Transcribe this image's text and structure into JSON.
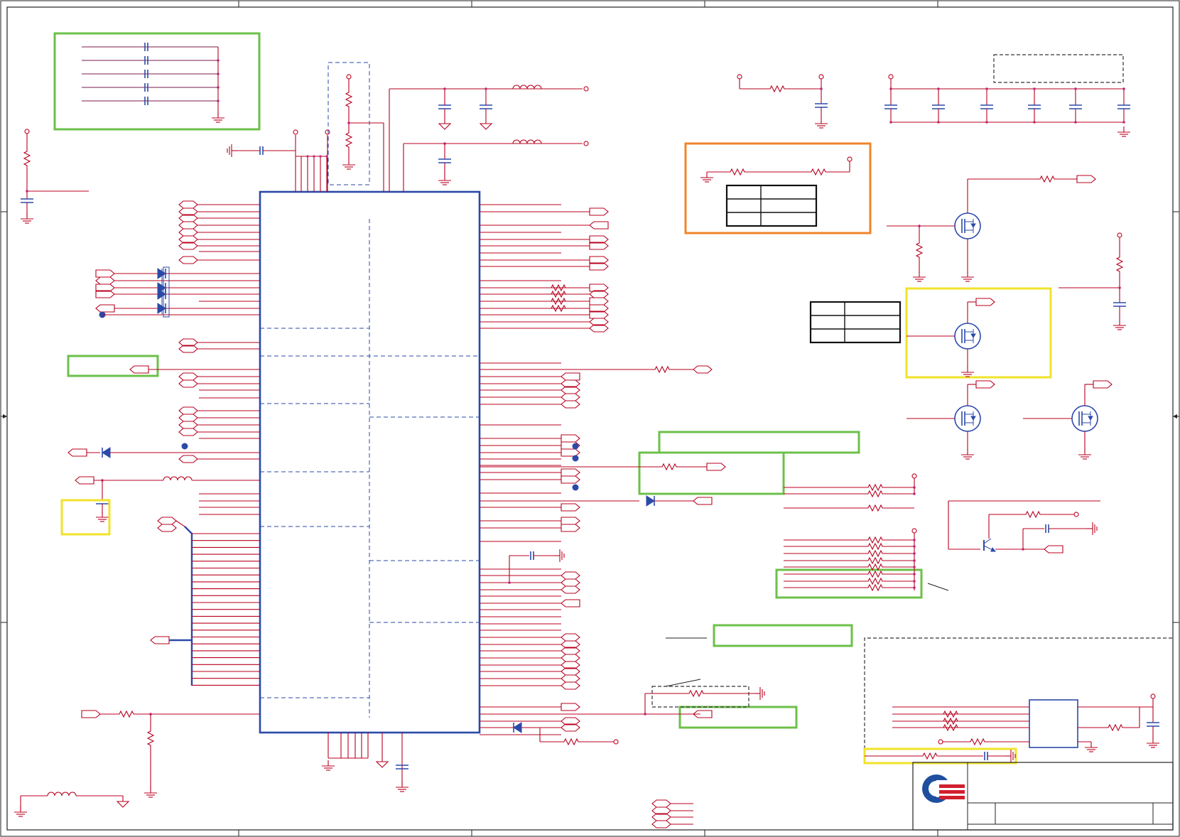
{
  "diagram": {
    "colors": {
      "wire": "#b8001f",
      "net": "#7a1b4a",
      "symbol": "#2b4aa8",
      "frame": "#222222",
      "highlight_green": "#6cc04a",
      "highlight_yellow": "#f0e32a",
      "highlight_orange": "#f0842a",
      "logo_blue": "#1f4f9e",
      "logo_red": "#d21f2e"
    },
    "components": {
      "main_ic": "ic-symbol",
      "transistors": "mosfet-icon",
      "resistors": "resistor-icon",
      "capacitors": "capacitor-icon",
      "inductors": "inductor-icon",
      "ground": "ground-icon",
      "power_flags": "power-port-icon",
      "net_ports": "port-arrow-icon",
      "diodes": "diode-icon"
    },
    "title_block": {
      "logo": "company-logo"
    }
  }
}
